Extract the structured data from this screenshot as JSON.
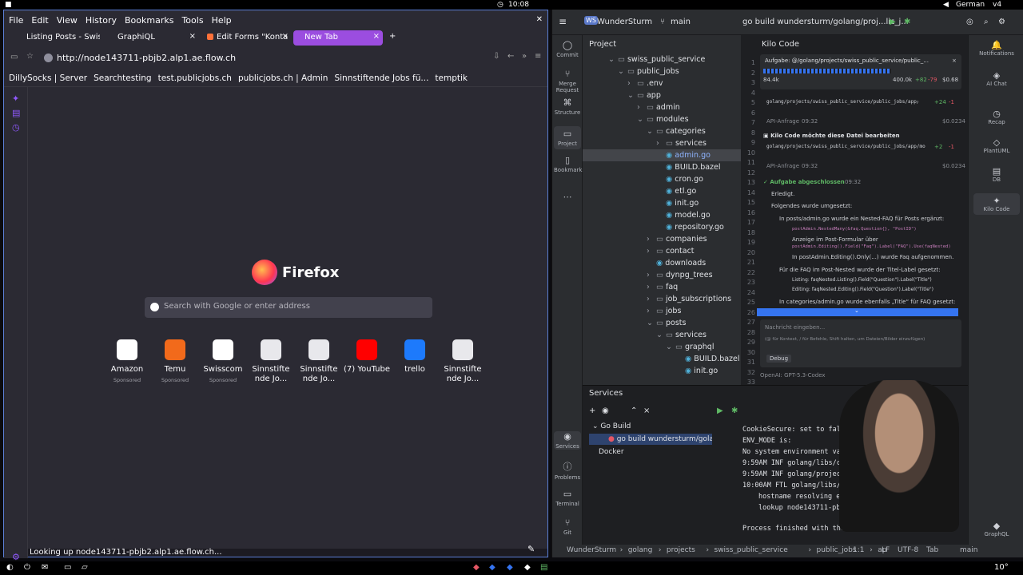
{
  "system": {
    "clock": "10:08",
    "keyboard": "German",
    "kb_suffix": "v4",
    "clock_bottom": "10°"
  },
  "firefox": {
    "menu": [
      "File",
      "Edit",
      "View",
      "History",
      "Bookmarks",
      "Tools",
      "Help"
    ],
    "tabs": [
      "Listing Posts - Swiss",
      "GraphiQL",
      "Edit Forms \"Konta",
      "New Tab"
    ],
    "new_tab_symbol": "+",
    "url": "http://node143711-pbjb2.alp1.ae.flow.ch",
    "bookmarks": [
      "DillySocks | Server",
      "Searchtesting",
      "test.publicjobs.ch",
      "publicjobs.ch | Admin",
      "Sinnstiftende Jobs fü...",
      "temptik"
    ],
    "brand": "Firefox",
    "search_placeholder": "Search with Google or enter address",
    "tiles": [
      {
        "label": "Amazon",
        "sub": "Sponsored",
        "color": "#ffffff"
      },
      {
        "label": "Temu",
        "sub": "Sponsored",
        "color": "#f26a1b"
      },
      {
        "label": "Swisscom",
        "sub": "Sponsored",
        "color": "#ffffff"
      },
      {
        "label": "Sinnstifte nde Jo...",
        "sub": "",
        "color": "#e8e8ec"
      },
      {
        "label": "Sinnstifte nde Jo...",
        "sub": "",
        "color": "#e8e8ec"
      },
      {
        "label": "(7) YouTube",
        "sub": "",
        "color": "#ff0000"
      },
      {
        "label": "trello",
        "sub": "",
        "color": "#1d7afc"
      },
      {
        "label": "Sinnstifte nde Jo...",
        "sub": "",
        "color": "#e8e8ec"
      }
    ],
    "status": "Looking up node143711-pbjb2.alp1.ae.flow.ch..."
  },
  "ide": {
    "project_badge": "WS",
    "project": "WunderSturm",
    "branch": "main",
    "run_config": "go build wundersturm/golang/proj...lic_j...",
    "left_strip": [
      "Commit",
      "Merge Request",
      "Structure",
      "Project",
      "Bookmarks"
    ],
    "right_strip": [
      "Notifications",
      "AI Chat",
      "Recap",
      "PlantUML",
      "DB",
      "Kilo Code",
      "GraphQL"
    ],
    "project_title": "Project",
    "tree": [
      {
        "t": "swiss_public_service",
        "d": 3,
        "arrow": "v"
      },
      {
        "t": "public_jobs",
        "d": 4,
        "arrow": "v"
      },
      {
        "t": ".env",
        "d": 5,
        "arrow": ">"
      },
      {
        "t": "app",
        "d": 5,
        "arrow": "v"
      },
      {
        "t": "admin",
        "d": 6,
        "arrow": ">"
      },
      {
        "t": "modules",
        "d": 6,
        "arrow": "v"
      },
      {
        "t": "categories",
        "d": 7,
        "arrow": "v"
      },
      {
        "t": "services",
        "d": 8,
        "arrow": ">"
      },
      {
        "t": "admin.go",
        "d": 8,
        "arrow": "",
        "sel": true
      },
      {
        "t": "BUILD.bazel",
        "d": 8,
        "arrow": ""
      },
      {
        "t": "cron.go",
        "d": 8,
        "arrow": ""
      },
      {
        "t": "etl.go",
        "d": 8,
        "arrow": ""
      },
      {
        "t": "init.go",
        "d": 8,
        "arrow": ""
      },
      {
        "t": "model.go",
        "d": 8,
        "arrow": ""
      },
      {
        "t": "repository.go",
        "d": 8,
        "arrow": ""
      },
      {
        "t": "companies",
        "d": 7,
        "arrow": ">"
      },
      {
        "t": "contact",
        "d": 7,
        "arrow": ">"
      },
      {
        "t": "downloads",
        "d": 7,
        "arrow": ""
      },
      {
        "t": "dynpg_trees",
        "d": 7,
        "arrow": ">"
      },
      {
        "t": "faq",
        "d": 7,
        "arrow": ">"
      },
      {
        "t": "job_subscriptions",
        "d": 7,
        "arrow": ">"
      },
      {
        "t": "jobs",
        "d": 7,
        "arrow": ">"
      },
      {
        "t": "posts",
        "d": 7,
        "arrow": "v"
      },
      {
        "t": "services",
        "d": 8,
        "arrow": "v"
      },
      {
        "t": "graphql",
        "d": 9,
        "arrow": "v"
      },
      {
        "t": "BUILD.bazel",
        "d": 10,
        "arrow": ""
      },
      {
        "t": "init.go",
        "d": 10,
        "arrow": ""
      }
    ],
    "gutter": [
      "1",
      "2",
      "3",
      "4",
      "5",
      "6",
      "7",
      "8",
      "9",
      "10",
      "11",
      "12",
      "13",
      "14",
      "15",
      "16",
      "17",
      "18",
      "19",
      "20",
      "21",
      "22",
      "23",
      "24",
      "25",
      "26",
      "27",
      "28",
      "29",
      "30",
      "31",
      "32",
      "33"
    ],
    "kilo": {
      "title": "Kilo Code",
      "task": "Aufgabe: @/golang/projects/swiss_public_service/public_...",
      "tokens_in": "84.4k",
      "tokens_ctx": "400.0k",
      "lines_add": "+82",
      "lines_del": "-79",
      "cost": "$0.68",
      "path1": "golang/projects/swiss_public_service/public_jobs/app/m...",
      "path1_add": "+24",
      "path1_del": "-1",
      "api1": "API-Anfrage",
      "api1_time": "09:32",
      "api1_cost": "$0.0234",
      "edit_title": "Kilo Code möchte diese Datei bearbeiten",
      "path2": "golang/projects/swiss_public_service/public_jobs/app/mo...",
      "path2_add": "+2",
      "path2_del": "-1",
      "api2": "API-Anfrage",
      "api2_time": "09:32",
      "api2_cost": "$0.0234",
      "done": "Aufgabe abgeschlossen",
      "done_time": "09:32",
      "done_1": "Erledigt.",
      "done_2": "Folgendes wurde umgesetzt:",
      "b1": "In posts/admin.go wurde ein Nested-FAQ für Posts ergänzt:",
      "b1a": "postAdmin.NestedMany(&faq.Question{}, \"PostID\")",
      "b1b": "Anzeige im Post-Formular über",
      "b1b2": "postAdmin.Editing().Field(\"Faq\").Label(\"FAQ\").Use(faqNested)",
      "b1c": "In postAdmin.Editing().Only(...) wurde Faq aufgenommen.",
      "b2": "Für die FAQ im Post-Nested wurde der Titel-Label gesetzt:",
      "b2a": "Listing: faqNested.Listing().Field(\"Question\").Label(\"Title\")",
      "b2b": "Editing: faqNested.Editing().Field(\"Question\").Label(\"Title\")",
      "b3": "In categories/admin.go wurde ebenfalls „Title“ für FAQ gesetzt:",
      "input_placeholder": "Nachricht eingeben...",
      "input_hint": "(@ für Kontext, / für Befehle, Shift halten, um Dateien/Bilder einzufügen)",
      "mode": "Debug",
      "model": "OpenAI: GPT-5.3-Codex"
    },
    "services": {
      "title": "Services",
      "items": [
        "Go Build",
        "go build wundersturm/golan",
        "Docker"
      ],
      "log": [
        {
          "t": "CookieSecure: set to false for lo",
          "c": "#dfe1e5"
        },
        {
          "t": "ENV_MODE is:",
          "c": "#dfe1e5"
        },
        {
          "t": "No system environment variable",
          "c": "#dfe1e5"
        },
        {
          "t": "9:59AM INF golang/libs/core/in",
          "c": "#dfe1e5"
        },
        {
          "t": "9:59AM INF golang/projects/swi",
          "c": "#dfe1e5"
        },
        {
          "t": "10:00AM FTL golang/libs/servic",
          "c": "#dfe1e5"
        },
        {
          "t": "  hostname resolving error: lo",
          "c": "#dfe1e5"
        },
        {
          "t": "  lookup node143711-pbjb2.alp1",
          "c": "#dfe1e5"
        },
        {
          "t": "",
          "c": "#dfe1e5"
        },
        {
          "t": "Process finished with the exit code 1",
          "c": "#dfe1e5"
        }
      ]
    },
    "breadcrumb": [
      "WunderSturm",
      "golang",
      "projects",
      "swiss_public_service",
      "public_jobs",
      "ap"
    ],
    "status": {
      "pos": "1:1",
      "lf": "LF",
      "enc": "UTF-8",
      "indent": "Tab",
      "branch": "main"
    },
    "left_bottom": [
      "Services",
      "Problems",
      "Terminal",
      "Git"
    ]
  }
}
